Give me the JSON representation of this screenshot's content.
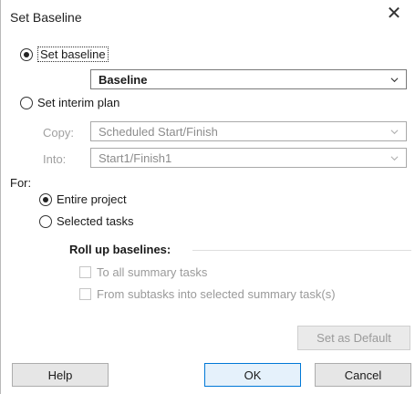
{
  "window": {
    "title": "Set Baseline",
    "close_glyph": "✕"
  },
  "set_baseline": {
    "label": "Set baseline",
    "checked": true,
    "dropdown_value": "Baseline"
  },
  "set_interim": {
    "label": "Set interim plan",
    "checked": false,
    "copy_label": "Copy:",
    "copy_value": "Scheduled Start/Finish",
    "into_label": "Into:",
    "into_value": "Start1/Finish1"
  },
  "for_section": {
    "label": "For:",
    "entire_project": {
      "label": "Entire project",
      "checked": true
    },
    "selected_tasks": {
      "label": "Selected tasks",
      "checked": false
    }
  },
  "rollup": {
    "heading": "Roll up baselines:",
    "to_all_summary": {
      "label": "To all summary tasks",
      "checked": false
    },
    "from_subtasks": {
      "label": "From subtasks into selected summary task(s)",
      "checked": false
    }
  },
  "buttons": {
    "set_as_default": "Set as Default",
    "help": "Help",
    "ok": "OK",
    "cancel": "Cancel"
  },
  "colors": {
    "primary_button_border": "#0078d7",
    "disabled_text": "#9a9a9a"
  },
  "icons": {
    "close": "close-icon",
    "dropdown": "chevron-down-icon"
  }
}
